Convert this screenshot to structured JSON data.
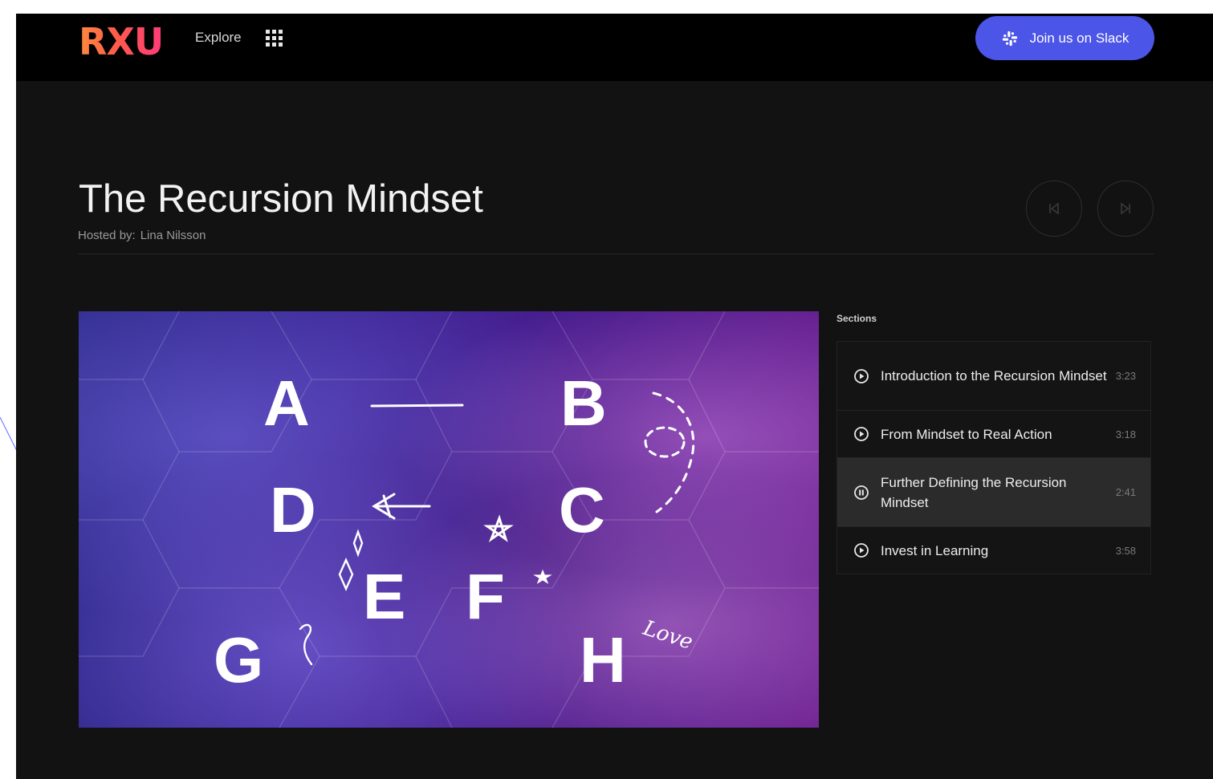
{
  "header": {
    "logo": "RXU",
    "explore_label": "Explore",
    "slack_button_label": "Join us on Slack"
  },
  "course": {
    "title": "The Recursion Mindset",
    "hosted_label": "Hosted by:",
    "host_name": "Lina Nilsson"
  },
  "video": {
    "letters": [
      "A",
      "B",
      "C",
      "D",
      "E",
      "F",
      "G",
      "H"
    ],
    "doodle_text": "Love"
  },
  "sections": {
    "label": "Sections",
    "items": [
      {
        "title": "Introduction to the Recursion Mindset",
        "duration": "3:23",
        "state": "play"
      },
      {
        "title": "From Mindset to Real Action",
        "duration": "3:18",
        "state": "play"
      },
      {
        "title": "Further Defining the Recursion Mindset",
        "duration": "2:41",
        "state": "pause"
      },
      {
        "title": "Invest in Learning",
        "duration": "3:58",
        "state": "play"
      }
    ]
  },
  "colors": {
    "accent": "#4b55e8",
    "background": "#121212",
    "topbar": "#000000",
    "active_row": "#2b2b2b"
  }
}
